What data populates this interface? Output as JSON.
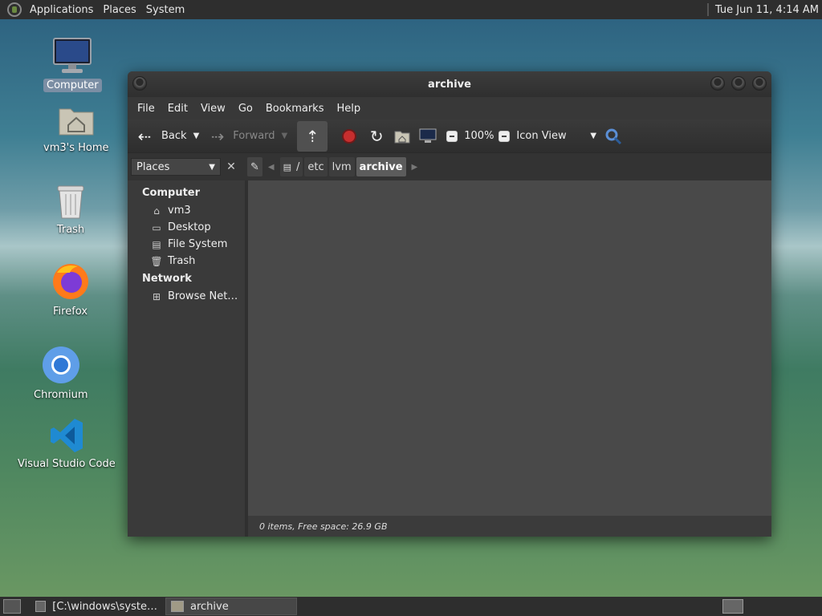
{
  "top_panel": {
    "menus": [
      "Applications",
      "Places",
      "System"
    ],
    "clock": "Tue Jun 11,  4:14 AM"
  },
  "desktop": {
    "icons": [
      {
        "label": "Computer",
        "icon": "computer-icon"
      },
      {
        "label": "vm3's Home",
        "icon": "home-folder-icon"
      },
      {
        "label": "Trash",
        "icon": "trash-icon"
      },
      {
        "label": "Firefox",
        "icon": "firefox-icon"
      },
      {
        "label": "Chromium",
        "icon": "chromium-icon"
      },
      {
        "label": "Visual Studio Code",
        "icon": "vscode-icon"
      }
    ]
  },
  "window": {
    "title": "archive",
    "menu": [
      "File",
      "Edit",
      "View",
      "Go",
      "Bookmarks",
      "Help"
    ],
    "toolbar": {
      "back": "Back",
      "forward": "Forward",
      "zoom": "100%",
      "view_mode": "Icon View"
    },
    "sidebar_select": "Places",
    "path": [
      "/",
      "etc",
      "lvm",
      "archive"
    ],
    "sidebar": {
      "computer_heading": "Computer",
      "computer_items": [
        "vm3",
        "Desktop",
        "File System",
        "Trash"
      ],
      "network_heading": "Network",
      "network_items": [
        "Browse Net…"
      ]
    },
    "status": "0 items, Free space: 26.9 GB"
  },
  "taskbar": {
    "tasks": [
      "[C:\\windows\\syste…",
      "archive"
    ]
  },
  "colors": {
    "panel": "#2e2e2e",
    "window_bg": "#3a3a3a",
    "content_bg": "#494949",
    "stop_red": "#c62e2e"
  }
}
